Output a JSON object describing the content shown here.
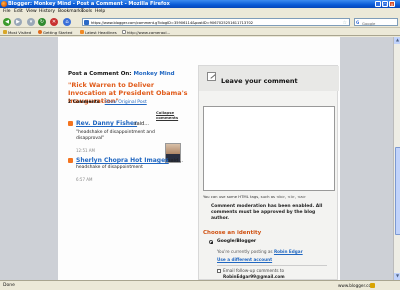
{
  "window": {
    "title": "Blogger: Monkey Mind - Post a Comment - Mozilla Firefox"
  },
  "menu": [
    "File",
    "Edit",
    "View",
    "History",
    "Bookmarks",
    "Tools",
    "Help"
  ],
  "toolbar": {
    "url": "https://www.blogger.com/comment.g?blogID=35906114&postID=9067025251611713702",
    "search_placeholder": "Google"
  },
  "bookmarks": [
    {
      "label": "Most Visited",
      "icon": "folder-icon",
      "color": "#d8a72a"
    },
    {
      "label": "Getting Started",
      "icon": "firefox-icon",
      "color": "#e06a1c"
    },
    {
      "label": "Latest Headlines",
      "icon": "rss-icon",
      "color": "#f08a24"
    },
    {
      "label": "http://www.cameraol...",
      "icon": "page-icon",
      "color": "#ffffff"
    }
  ],
  "page": {
    "post_caption": "Post a Comment On:",
    "blog_name": "Monkey Mind",
    "post_title": "\"Rick Warren to Deliver Invocation at President Obama's Inauguration\"",
    "comment_count": "2 Comments",
    "show_original": "Show Original Post",
    "collapse_link": "Collapse comments",
    "comments": [
      {
        "author": "Rev. Danny Fisher",
        "said": "said...",
        "body": "\"headshake of disappointment and disapproval\"",
        "time": "12:51 AM"
      },
      {
        "author": "Sherlyn Chopra Hot Images",
        "said": "said...",
        "body": "headshake of disappointment",
        "time": "6:57 AM"
      }
    ],
    "form": {
      "heading": "Leave your comment",
      "html_note": "You can use some HTML tags, such as <b>, <i>, <a>",
      "moderation": "Comment moderation has been enabled. All comments must be approved by the blog author.",
      "choose_identity": "Choose an identity",
      "identity_option": "Google/Blogger",
      "posting_as_prefix": "You're currently posting as",
      "posting_as_user": "Robin Edgar",
      "different_account": "Use a different account",
      "followup_label": "Email follow-up comments to",
      "followup_email": "RobinEdgar99@gmail.com"
    }
  },
  "status": {
    "text": "Done",
    "host": "www.blogger.com"
  },
  "colors": {
    "accent_orange": "#e05a19",
    "link_blue": "#1f66c1",
    "titlebar_blue": "#0a5bd6"
  }
}
